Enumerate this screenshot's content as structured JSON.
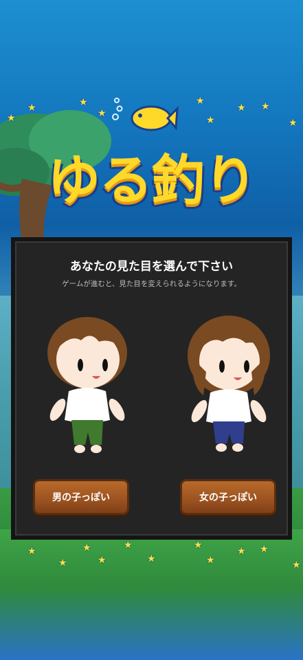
{
  "game": {
    "logo_text": "ゆる釣り"
  },
  "dialog": {
    "title": "あなたの見た目を選んで下さい",
    "subtitle": "ゲームが進むと、見た目を変えられるようになります。",
    "options": [
      {
        "label": "男の子っぽい"
      },
      {
        "label": "女の子っぽい"
      }
    ]
  },
  "colors": {
    "panel_bg": "#242424",
    "button_brown": "#9b5220",
    "logo_yellow": "#ffd92a",
    "sky_blue": "#1478bf"
  },
  "icons": [
    "fish-icon",
    "star-icon",
    "bubble-icon"
  ]
}
